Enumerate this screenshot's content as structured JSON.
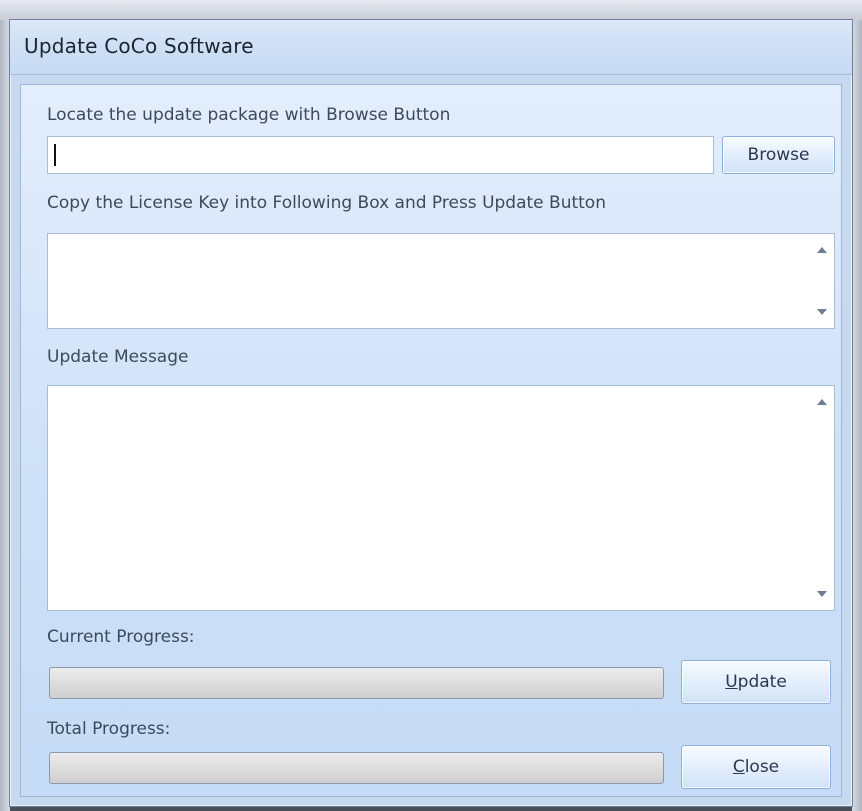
{
  "window": {
    "title": "Update CoCo Software"
  },
  "labels": {
    "locate": "Locate the update package with Browse Button",
    "license": "Copy the License Key into Following Box and Press Update Button",
    "message": "Update Message",
    "current_progress": "Current Progress:",
    "total_progress": "Total Progress:"
  },
  "inputs": {
    "package_path_value": "",
    "license_key_value": "",
    "update_message_value": ""
  },
  "buttons": {
    "browse": "Browse",
    "update_mnemonic": "U",
    "update_rest": "pdate",
    "close_mnemonic": "C",
    "close_rest": "lose"
  },
  "progress": {
    "current_fraction": 0,
    "total_fraction": 0
  },
  "icons": {
    "scroll_up": "chevron-up-icon",
    "scroll_down": "chevron-down-icon"
  },
  "colors": {
    "client_top": "#e3eefc",
    "client_bottom": "#c6dbf6",
    "progress_fill": "#3fbf3f"
  }
}
